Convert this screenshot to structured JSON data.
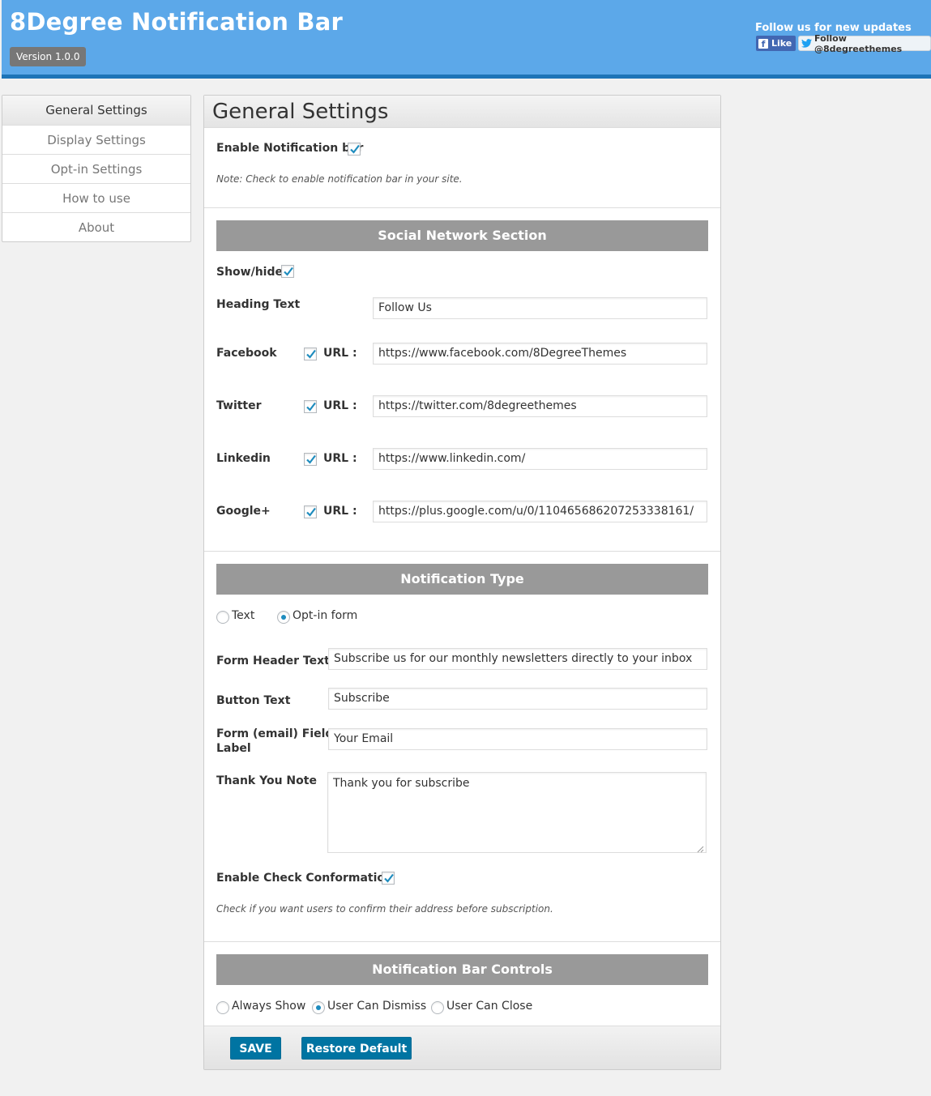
{
  "header": {
    "title": "8Degree Notification Bar",
    "version": "Version 1.0.0",
    "follow_text": "Follow us for new updates",
    "fb_like": "Like",
    "twitter_follow": "Follow @8degreethemes",
    "bg_color": "#5ca8e9"
  },
  "sidebar": {
    "items": [
      {
        "label": "General Settings",
        "active": true
      },
      {
        "label": "Display Settings",
        "active": false
      },
      {
        "label": "Opt-in Settings",
        "active": false
      },
      {
        "label": "How to use",
        "active": false
      },
      {
        "label": "About",
        "active": false
      }
    ]
  },
  "main": {
    "title": "General Settings",
    "enable_notification": {
      "label": "Enable Notification bar",
      "checked": true,
      "note": "Note: Check to enable notification bar in your site."
    },
    "social": {
      "section_title": "Social Network Section",
      "show_hide_label": "Show/hide",
      "show_hide_checked": true,
      "heading_label": "Heading Text",
      "heading_value": "Follow Us",
      "url_label": "URL :",
      "networks": [
        {
          "name": "Facebook",
          "checked": true,
          "url": "https://www.facebook.com/8DegreeThemes"
        },
        {
          "name": "Twitter",
          "checked": true,
          "url": "https://twitter.com/8degreethemes"
        },
        {
          "name": "Linkedin",
          "checked": true,
          "url": "https://www.linkedin.com/"
        },
        {
          "name": "Google+",
          "checked": true,
          "url": "https://plus.google.com/u/0/110465686207253338161/"
        }
      ]
    },
    "notification_type": {
      "section_title": "Notification Type",
      "options": [
        {
          "label": "Text",
          "selected": false
        },
        {
          "label": "Opt-in form",
          "selected": true
        }
      ],
      "form_header_label": "Form Header Text",
      "form_header_value": "Subscribe us for our monthly newsletters directly to your inbox",
      "button_text_label": "Button Text",
      "button_text_value": "Subscribe",
      "email_label_line1": "Form (email) Field",
      "email_label_line2": "Label",
      "email_label_value": "Your Email",
      "thank_you_label": "Thank You Note",
      "thank_you_value": "Thank you for subscribe",
      "confirm_label": "Enable Check Conformation",
      "confirm_checked": true,
      "confirm_note": "Check if you want users to confirm their address before subscription."
    },
    "controls": {
      "section_title": "Notification Bar Controls",
      "options": [
        {
          "label": "Always Show",
          "selected": false
        },
        {
          "label": "User Can Dismiss",
          "selected": true
        },
        {
          "label": "User Can Close",
          "selected": false
        }
      ]
    },
    "footer": {
      "save_label": "SAVE",
      "restore_label": "Restore Default"
    }
  },
  "colors": {
    "accent": "#0074a2",
    "section_bar": "#999999",
    "check": "#1e8cbe"
  }
}
